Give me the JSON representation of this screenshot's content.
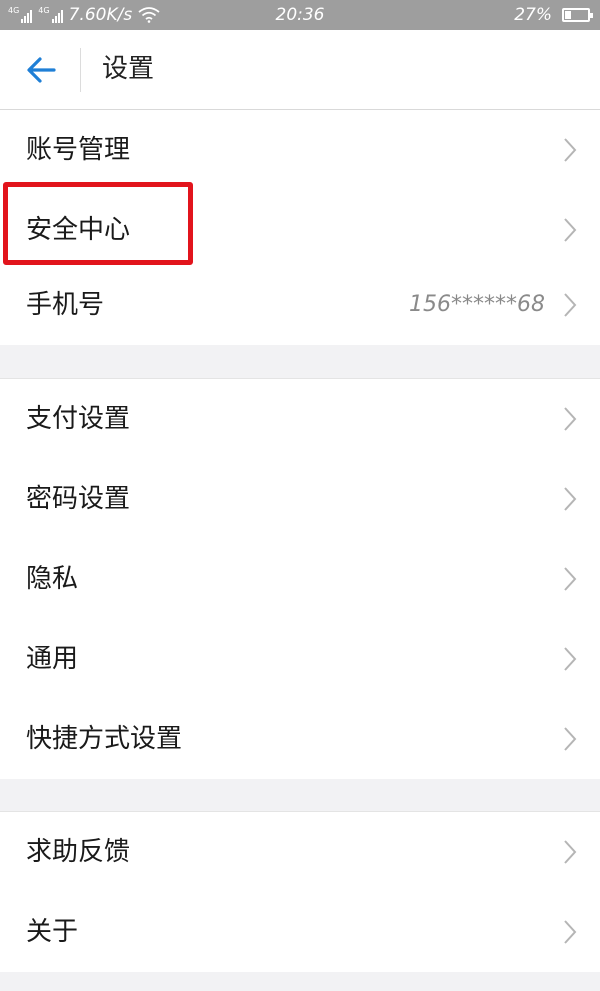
{
  "status_bar": {
    "network_speed": "7.60K/s",
    "time": "20:36",
    "battery": "27%",
    "battery_level": 0.27,
    "icons": [
      "signal-icon",
      "signal-icon",
      "wifi-icon",
      "battery-icon"
    ]
  },
  "header": {
    "back_icon": "back-arrow-icon",
    "title": "设置"
  },
  "groups": [
    {
      "items": [
        {
          "label": "账号管理"
        },
        {
          "label": "安全中心"
        },
        {
          "label": "手机号",
          "value": "156******68"
        }
      ]
    },
    {
      "items": [
        {
          "label": "支付设置"
        },
        {
          "label": "密码设置"
        },
        {
          "label": "隐私"
        },
        {
          "label": "通用"
        },
        {
          "label": "快捷方式设置"
        }
      ]
    },
    {
      "items": [
        {
          "label": "求助反馈"
        },
        {
          "label": "关于"
        }
      ]
    }
  ],
  "highlight": {
    "target": "安全中心",
    "color": "#e2141c"
  },
  "colors": {
    "accent": "#1f7fd6",
    "highlight": "#e2141c",
    "chevron": "#b5b5b5"
  }
}
